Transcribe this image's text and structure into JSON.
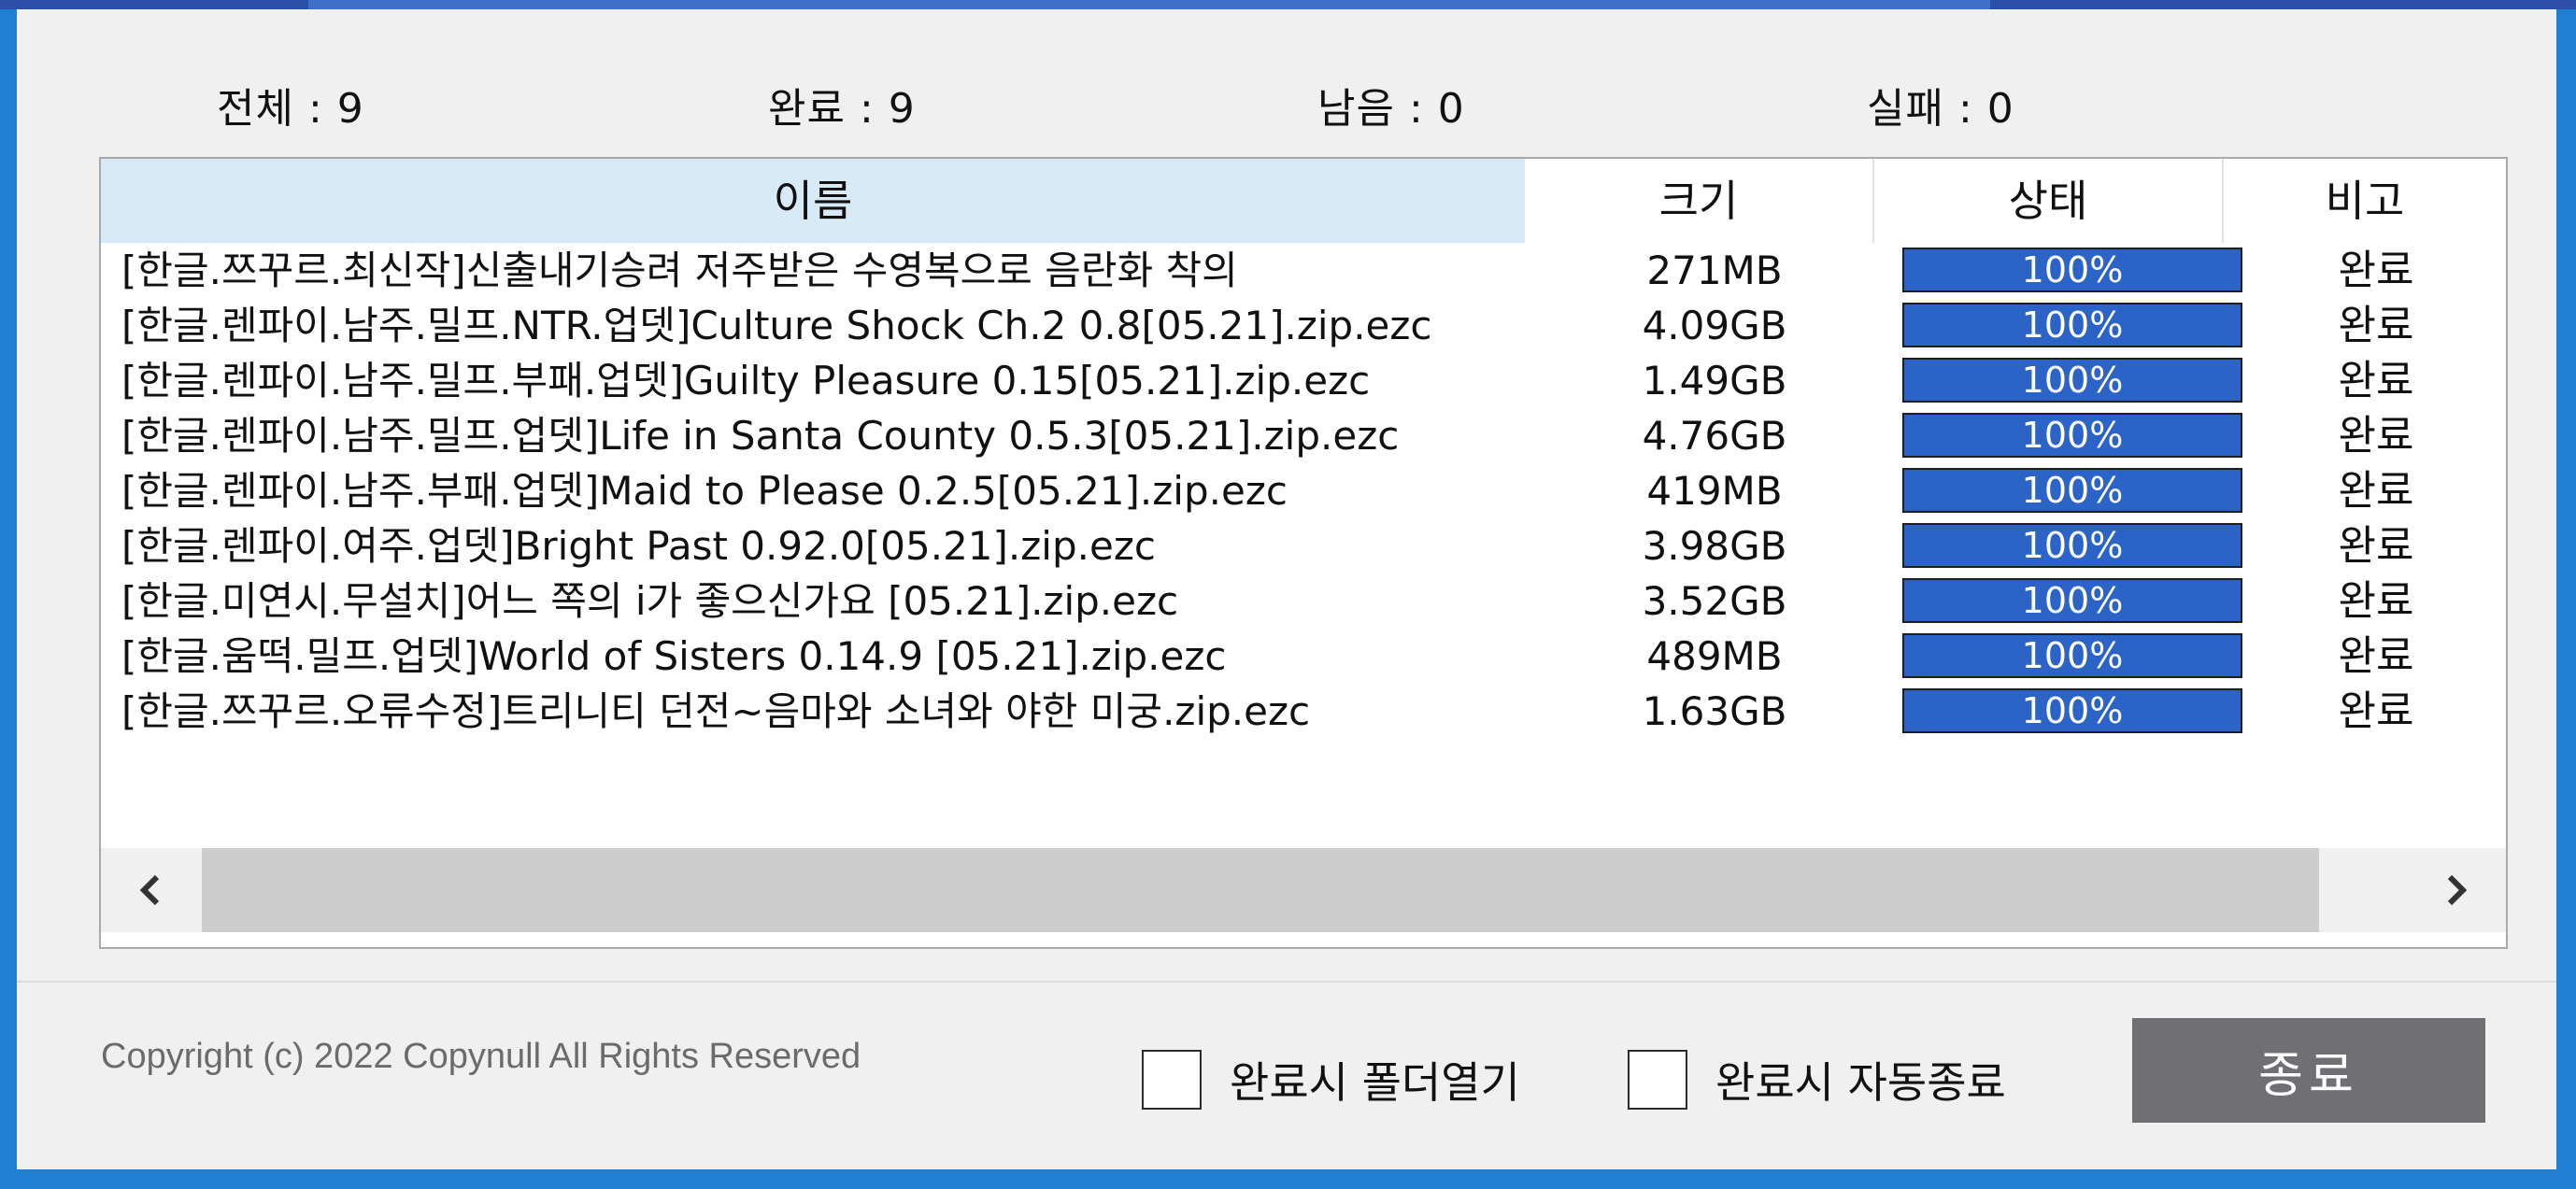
{
  "counts": [
    {
      "label": "전체 : 9"
    },
    {
      "label": "완료 : 9"
    },
    {
      "label": "남음 : 0"
    },
    {
      "label": "실패 : 0"
    }
  ],
  "table": {
    "headers": {
      "name": "이름",
      "size": "크기",
      "status": "상태",
      "note": "비고"
    },
    "rows": [
      {
        "name": "[한글.쯔꾸르.최신작]신출내기승려 저주받은 수영복으로 음란화 착의",
        "size": "271MB",
        "progress": 100,
        "progress_text": "100%",
        "note": "완료"
      },
      {
        "name": "[한글.렌파이.남주.밀프.NTR.업뎃]Culture Shock Ch.2 0.8[05.21].zip.ezc",
        "size": "4.09GB",
        "progress": 100,
        "progress_text": "100%",
        "note": "완료"
      },
      {
        "name": "[한글.렌파이.남주.밀프.부패.업뎃]Guilty Pleasure 0.15[05.21].zip.ezc",
        "size": "1.49GB",
        "progress": 100,
        "progress_text": "100%",
        "note": "완료"
      },
      {
        "name": "[한글.렌파이.남주.밀프.업뎃]Life in Santa County 0.5.3[05.21].zip.ezc",
        "size": "4.76GB",
        "progress": 100,
        "progress_text": "100%",
        "note": "완료"
      },
      {
        "name": "[한글.렌파이.남주.부패.업뎃]Maid to Please 0.2.5[05.21].zip.ezc",
        "size": "419MB",
        "progress": 100,
        "progress_text": "100%",
        "note": "완료"
      },
      {
        "name": "[한글.렌파이.여주.업뎃]Bright Past 0.92.0[05.21].zip.ezc",
        "size": "3.98GB",
        "progress": 100,
        "progress_text": "100%",
        "note": "완료"
      },
      {
        "name": "[한글.미연시.무설치]어느 쪽의 i가 좋으신가요 [05.21].zip.ezc",
        "size": "3.52GB",
        "progress": 100,
        "progress_text": "100%",
        "note": "완료"
      },
      {
        "name": "[한글.움떡.밀프.업뎃]World of Sisters 0.14.9 [05.21].zip.ezc",
        "size": "489MB",
        "progress": 100,
        "progress_text": "100%",
        "note": "완료"
      },
      {
        "name": "[한글.쯔꾸르.오류수정]트리니티 던전~음마와 소녀와 야한 미궁.zip.ezc",
        "size": "1.63GB",
        "progress": 100,
        "progress_text": "100%",
        "note": "완료"
      }
    ]
  },
  "scroll_icons": {
    "left": "chevron-left-icon",
    "right": "chevron-right-icon"
  },
  "footer": {
    "copyright": "Copyright (c) 2022 Copynull All Rights Reserved",
    "open_folder_label": "완료시 폴더열기",
    "auto_exit_label": "완료시 자동종료",
    "open_folder_checked": false,
    "auto_exit_checked": false,
    "exit_label": "종료"
  },
  "colors": {
    "window_bg": "#f0f0f0",
    "desktop_bg": "#1f7fd2",
    "progress_fill": "#2b63c6",
    "header_name_bg": "#d9eaf7",
    "exit_button_bg": "#6f6f74"
  }
}
